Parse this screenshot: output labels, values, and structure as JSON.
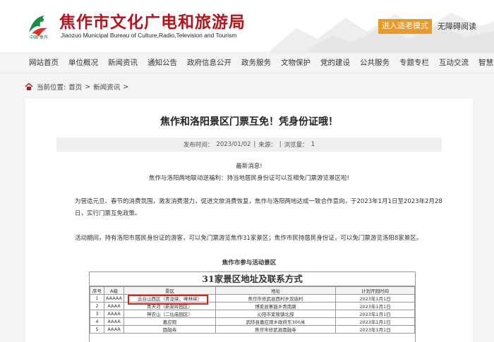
{
  "header": {
    "title_cn": "焦作市文化广电和旅游局",
    "title_en": "Jiaozuo Municipal Bureau of Culture,Radio,Television and Tourism",
    "logo_caption": "中国 焦作",
    "elder_mode_button": "进入适老模式",
    "accessible_reading": "无障碍阅读",
    "brand_color": "#b4141c",
    "accent_color": "#e89b2c"
  },
  "nav": {
    "items": [
      "网站首页",
      "单位概况",
      "新闻资讯",
      "通知公告",
      "政府信息公开",
      "政务服务",
      "文物保护",
      "党的建设",
      "公共服务",
      "专题专栏",
      "互动交流",
      "智慧金服"
    ]
  },
  "breadcrumb": {
    "label": "当前位置:",
    "home": "首页",
    "section": "新闻资讯",
    "sep": ">"
  },
  "article": {
    "title": "焦作和洛阳景区门票互免！凭身份证哦！",
    "published_label": "发布时间：",
    "published_date": "2023/01/02",
    "source_label": "来源：",
    "views_label": "浏览量：",
    "views": "1",
    "headline": "最新消息!",
    "subheadline": "焦作与洛阳两地联动送福利：持当地居民身份证可以互相免门票游览景区啦!",
    "paragraph1": "为营造元旦、春节的消费氛围，激发消费潜力，促进文旅消费恢复，焦作与洛阳两地达成一致合作意向，于2023年1月1日至2023年2月28日，实行门票互免政策。",
    "paragraph2": "活动期间，持有洛阳市居民身份证的游客，可以免门票游览焦作31家景区；焦作市民持居民身份证，可以免门票游览洛阳8家景区。",
    "section_heading": "焦作市参与活动景区"
  },
  "table": {
    "title": "31家景区地址及联系方式",
    "headers": [
      "序号",
      "A级",
      "景区",
      "地址",
      "计划开园时间"
    ],
    "rows": [
      [
        "1",
        "AAAAA",
        "云台山西区（青龙峡、峰林峡）",
        "焦作市修武县西村乡双庙村",
        "2023年1月1日"
      ],
      [
        "2",
        "AAAA",
        "青天河（新家岭园区）",
        "博爱县寨豁乡青南路",
        "2023年1月1日"
      ],
      [
        "3",
        "AAAA",
        "神农山（二仙庙园区）",
        "沁阳市紫陵镇北部",
        "2023年1月1日"
      ],
      [
        "4",
        "AAAA",
        "嘉应观",
        "武陟县嘉应观乡政府东300米",
        "2023年1月1日"
      ],
      [
        "5",
        "AAAA",
        "圆融寺",
        "焦作市修武县圆融寺",
        "2023年1月1日"
      ]
    ],
    "highlight_color": "#e0201c"
  }
}
